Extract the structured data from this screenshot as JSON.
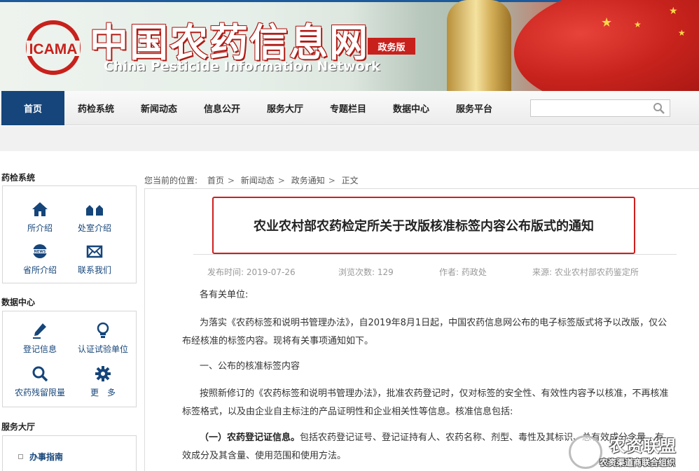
{
  "header": {
    "title_cn": "中国农药信息网",
    "title_en": "China Pesticide Information Network",
    "edition_badge": "政务版",
    "logo_text": "ICAMA"
  },
  "nav": {
    "items": [
      "首页",
      "药检系统",
      "新闻动态",
      "信息公开",
      "服务大厅",
      "专题栏目",
      "数据中心",
      "服务平台"
    ],
    "active_index": 0,
    "search_placeholder": ""
  },
  "sidebar": {
    "sections": [
      {
        "title": "药检系统",
        "items": [
          {
            "label": "所介绍",
            "icon": "home-icon"
          },
          {
            "label": "处室介绍",
            "icon": "buildings-icon"
          },
          {
            "label": "省所介绍",
            "icon": "news-globe-icon"
          },
          {
            "label": "联系我们",
            "icon": "envelope-icon"
          }
        ]
      },
      {
        "title": "数据中心",
        "items": [
          {
            "label": "登记信息",
            "icon": "pencil-icon"
          },
          {
            "label": "认证试验单位",
            "icon": "lightbulb-icon"
          },
          {
            "label": "农药残留限量",
            "icon": "search-icon"
          },
          {
            "label": "更　多",
            "icon": "gear-icon"
          }
        ]
      },
      {
        "title": "服务大厅",
        "items": [
          {
            "label": "办事指南"
          }
        ]
      }
    ]
  },
  "breadcrumb": {
    "prefix": "您当前的位置:",
    "items": [
      "首页",
      "新闻动态",
      "政务通知",
      "正文"
    ]
  },
  "article": {
    "title": "农业农村部农药检定所关于改版核准标签内容公布版式的通知",
    "meta": {
      "published": "发布时间: 2019-07-26",
      "views": "浏览次数: 129",
      "author": "作者: 药政处",
      "source": "来源:   农业农村部农药鉴定所"
    },
    "salutation": "各有关单位:",
    "paragraphs": [
      "为落实《农药标签和说明书管理办法》，自2019年8月1日起，中国农药信息网公布的电子标签版式将予以改版，仅公布经核准的标签内容。现将有关事项通知如下。",
      "一、公布的核准标签内容",
      "按照新修订的《农药标签和说明书管理办法》，批准农药登记时，仅对标签的安全性、有效性内容予以核准，不再核准标签格式，以及由企业自主标注的产品证明性和企业相关性等信息。核准信息包括:"
    ],
    "item_one": {
      "lead": "（一）农药登记证信息。",
      "text": "包括农药登记证号、登记证持有人、农药名称、剂型、毒性及其标识、总有效成分含量、有效成分及其含量、使用范围和使用方法。"
    }
  },
  "watermark": {
    "main": "农资联盟",
    "sub": "农资渠道商联合组织"
  },
  "colors": {
    "nav_active": "#15457a",
    "title_border": "#d01e1e",
    "badge": "#c8211c",
    "link_blue": "#15457a"
  }
}
